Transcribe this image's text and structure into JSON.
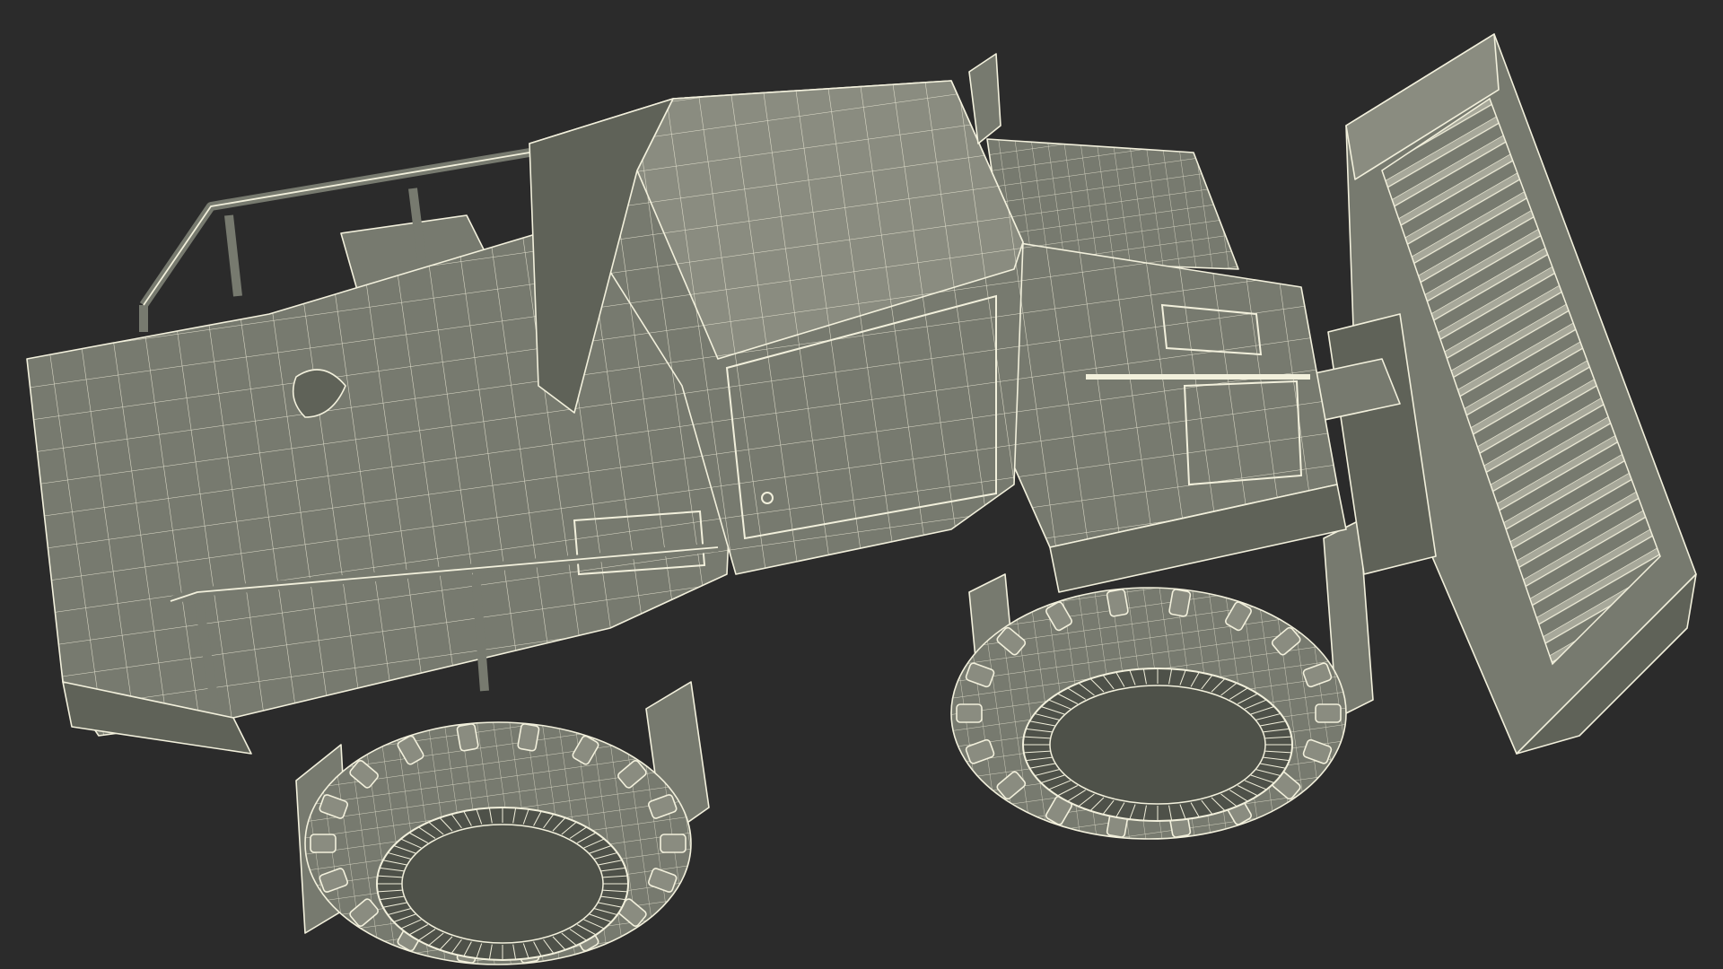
{
  "scene": {
    "subject": "soil-compactor-wireframe",
    "background_color": "#2b2b2b",
    "surface_color": "#777a6f",
    "surface_light_color": "#8a8c80",
    "surface_dark_color": "#5f6258",
    "wire_color": "#f2f0dc",
    "rim_color": "#4e5149"
  }
}
